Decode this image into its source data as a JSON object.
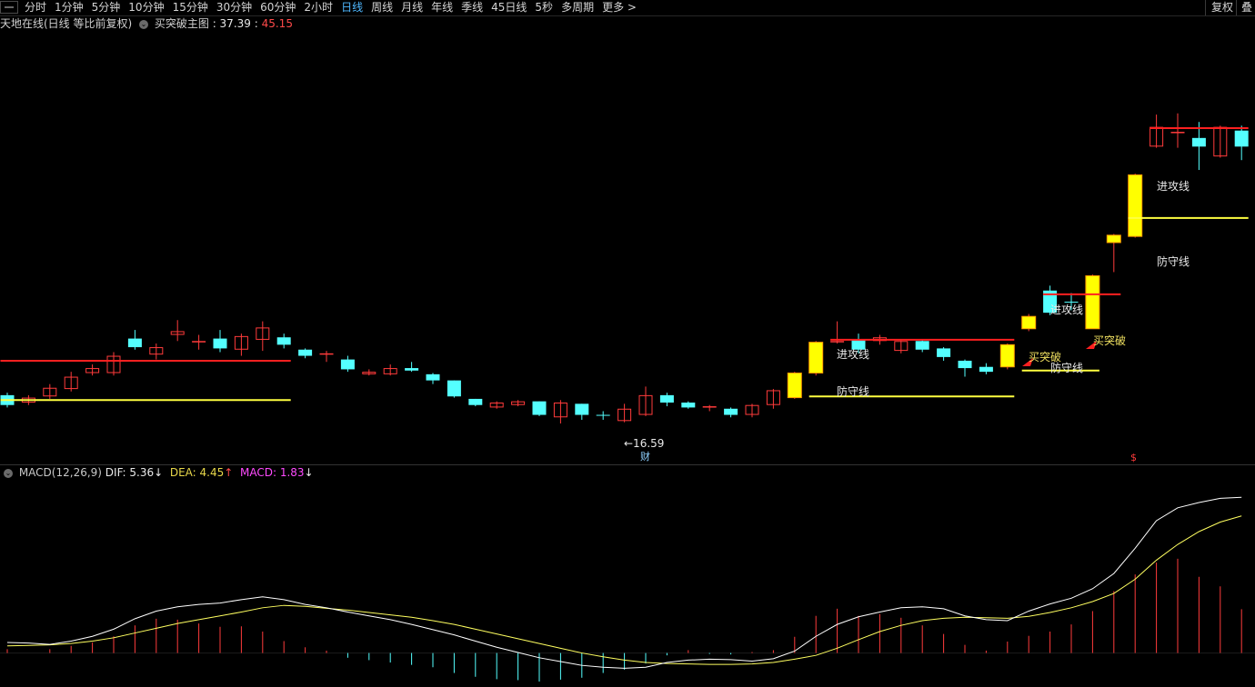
{
  "toolbar": {
    "periods": [
      "分时",
      "1分钟",
      "5分钟",
      "10分钟",
      "15分钟",
      "30分钟",
      "60分钟",
      "2小时",
      "日线",
      "周线",
      "月线",
      "年线",
      "季线",
      "45日线",
      "5秒",
      "多周期",
      "更多 >"
    ],
    "active_period": "日线",
    "restore_label": "复权",
    "overlay_label": "叠"
  },
  "info": {
    "stock_title": "天地在线(日线 等比前复权)",
    "indicator_name": "买突破主图",
    "value1": "37.39",
    "value2": "45.15"
  },
  "macd": {
    "name": "MACD(12,26,9)",
    "dif_label": "DIF:",
    "dif_value": "5.36",
    "dif_arrow": "↓",
    "dea_label": "DEA:",
    "dea_value": "4.45",
    "dea_arrow": "↑",
    "macd_label": "MACD:",
    "macd_value": "1.83",
    "macd_arrow": "↓"
  },
  "annotations": {
    "low_price": "←16.59",
    "finance_tag": "财",
    "dollar_tag": "$",
    "attack_line": "进攻线",
    "defense_line": "防守线",
    "buy_break": "买突破"
  },
  "colors": {
    "up": "#ff3b3b",
    "down": "#54ffff",
    "signal": "#ffff00",
    "attack": "#ff2020",
    "defense": "#ffff40",
    "dif": "#ffffff",
    "dea": "#ffff60"
  },
  "chart_data": {
    "type": "candlestick",
    "ylim": [
      15,
      50
    ],
    "candles": [
      {
        "o": 20.4,
        "c": 19.6,
        "h": 20.6,
        "l": 19.4,
        "t": "down"
      },
      {
        "o": 19.8,
        "c": 20.2,
        "h": 20.4,
        "l": 19.6,
        "t": "up"
      },
      {
        "o": 20.3,
        "c": 21.0,
        "h": 21.3,
        "l": 20.1,
        "t": "up"
      },
      {
        "o": 20.9,
        "c": 21.9,
        "h": 22.3,
        "l": 20.7,
        "t": "up"
      },
      {
        "o": 22.2,
        "c": 22.6,
        "h": 22.9,
        "l": 22.0,
        "t": "up"
      },
      {
        "o": 22.2,
        "c": 23.6,
        "h": 23.9,
        "l": 22.0,
        "t": "up"
      },
      {
        "o": 25.0,
        "c": 24.3,
        "h": 25.7,
        "l": 24.1,
        "t": "down"
      },
      {
        "o": 23.7,
        "c": 24.3,
        "h": 24.6,
        "l": 23.3,
        "t": "up"
      },
      {
        "o": 25.3,
        "c": 25.6,
        "h": 26.5,
        "l": 24.8,
        "t": "up"
      },
      {
        "o": 24.7,
        "c": 24.8,
        "h": 25.3,
        "l": 24.1,
        "t": "up"
      },
      {
        "o": 25.0,
        "c": 24.2,
        "h": 25.7,
        "l": 23.9,
        "t": "down"
      },
      {
        "o": 24.1,
        "c": 25.2,
        "h": 25.4,
        "l": 23.6,
        "t": "up"
      },
      {
        "o": 24.9,
        "c": 25.9,
        "h": 26.4,
        "l": 24.0,
        "t": "up"
      },
      {
        "o": 25.1,
        "c": 24.5,
        "h": 25.4,
        "l": 24.2,
        "t": "down"
      },
      {
        "o": 24.1,
        "c": 23.6,
        "h": 24.2,
        "l": 23.4,
        "t": "down"
      },
      {
        "o": 23.7,
        "c": 23.8,
        "h": 24.0,
        "l": 23.1,
        "t": "up"
      },
      {
        "o": 23.3,
        "c": 22.5,
        "h": 23.6,
        "l": 22.3,
        "t": "down"
      },
      {
        "o": 22.3,
        "c": 22.1,
        "h": 22.5,
        "l": 22.0,
        "t": "up"
      },
      {
        "o": 22.1,
        "c": 22.6,
        "h": 22.9,
        "l": 22.0,
        "t": "up"
      },
      {
        "o": 22.6,
        "c": 22.4,
        "h": 23.1,
        "l": 22.3,
        "t": "down"
      },
      {
        "o": 22.1,
        "c": 21.6,
        "h": 22.2,
        "l": 21.3,
        "t": "down"
      },
      {
        "o": 21.6,
        "c": 20.3,
        "h": 21.6,
        "l": 20.2,
        "t": "down"
      },
      {
        "o": 20.1,
        "c": 19.6,
        "h": 20.1,
        "l": 19.5,
        "t": "down"
      },
      {
        "o": 19.4,
        "c": 19.8,
        "h": 19.9,
        "l": 19.3,
        "t": "up"
      },
      {
        "o": 19.6,
        "c": 19.9,
        "h": 20.0,
        "l": 19.5,
        "t": "up"
      },
      {
        "o": 19.9,
        "c": 18.8,
        "h": 19.9,
        "l": 18.7,
        "t": "down"
      },
      {
        "o": 18.6,
        "c": 19.8,
        "h": 20.0,
        "l": 18.1,
        "t": "up"
      },
      {
        "o": 19.7,
        "c": 18.8,
        "h": 19.7,
        "l": 18.4,
        "t": "down"
      },
      {
        "o": 18.8,
        "c": 18.8,
        "h": 19.1,
        "l": 18.4,
        "t": "down"
      },
      {
        "o": 18.3,
        "c": 19.3,
        "h": 19.7,
        "l": 18.2,
        "t": "up"
      },
      {
        "o": 18.8,
        "c": 20.4,
        "h": 21.1,
        "l": 18.7,
        "t": "up"
      },
      {
        "o": 20.4,
        "c": 19.8,
        "h": 20.6,
        "l": 19.5,
        "t": "down"
      },
      {
        "o": 19.8,
        "c": 19.4,
        "h": 19.9,
        "l": 19.3,
        "t": "down"
      },
      {
        "o": 19.5,
        "c": 19.5,
        "h": 19.6,
        "l": 19.1,
        "t": "up"
      },
      {
        "o": 19.3,
        "c": 18.8,
        "h": 19.4,
        "l": 18.6,
        "t": "down"
      },
      {
        "o": 18.8,
        "c": 19.6,
        "h": 19.7,
        "l": 18.6,
        "t": "up"
      },
      {
        "o": 19.6,
        "c": 20.8,
        "h": 20.9,
        "l": 19.3,
        "t": "up"
      },
      {
        "o": 20.2,
        "c": 22.2,
        "h": 22.3,
        "l": 20.1,
        "t": "signal"
      },
      {
        "o": 22.2,
        "c": 24.7,
        "h": 24.8,
        "l": 22.0,
        "t": "signal"
      },
      {
        "o": 24.8,
        "c": 24.8,
        "h": 26.4,
        "l": 24.6,
        "t": "up"
      },
      {
        "o": 24.9,
        "c": 24.1,
        "h": 25.4,
        "l": 23.8,
        "t": "down"
      },
      {
        "o": 24.8,
        "c": 25.1,
        "h": 25.3,
        "l": 24.5,
        "t": "up"
      },
      {
        "o": 24.0,
        "c": 24.8,
        "h": 24.9,
        "l": 23.8,
        "t": "up"
      },
      {
        "o": 24.8,
        "c": 24.1,
        "h": 24.9,
        "l": 23.9,
        "t": "down"
      },
      {
        "o": 24.2,
        "c": 23.5,
        "h": 24.3,
        "l": 23.2,
        "t": "down"
      },
      {
        "o": 23.2,
        "c": 22.6,
        "h": 23.3,
        "l": 21.9,
        "t": "down"
      },
      {
        "o": 22.7,
        "c": 22.3,
        "h": 23.0,
        "l": 22.1,
        "t": "down"
      },
      {
        "o": 22.7,
        "c": 24.5,
        "h": 24.6,
        "l": 22.5,
        "t": "signal"
      },
      {
        "o": 25.8,
        "c": 26.8,
        "h": 27.0,
        "l": 25.6,
        "t": "signal"
      },
      {
        "o": 28.9,
        "c": 27.1,
        "h": 29.3,
        "l": 26.9,
        "t": "down"
      },
      {
        "o": 28.0,
        "c": 28.0,
        "h": 28.7,
        "l": 27.3,
        "t": "down"
      },
      {
        "o": 25.8,
        "c": 30.1,
        "h": 30.2,
        "l": 25.8,
        "t": "signal"
      },
      {
        "o": 32.8,
        "c": 33.4,
        "h": 33.5,
        "l": 30.4,
        "t": "signal"
      },
      {
        "o": 33.3,
        "c": 38.3,
        "h": 38.4,
        "l": 33.2,
        "t": "signal"
      },
      {
        "o": 40.6,
        "c": 42.2,
        "h": 43.2,
        "l": 40.5,
        "t": "up"
      },
      {
        "o": 41.8,
        "c": 41.8,
        "h": 43.3,
        "l": 40.5,
        "t": "up"
      },
      {
        "o": 41.3,
        "c": 40.6,
        "h": 42.6,
        "l": 38.7,
        "t": "down"
      },
      {
        "o": 39.8,
        "c": 42.2,
        "h": 42.3,
        "l": 39.7,
        "t": "up"
      },
      {
        "o": 40.6,
        "c": 41.9,
        "h": 42.3,
        "l": 39.5,
        "t": "down"
      }
    ],
    "attack_lines": [
      {
        "from": 0,
        "to": 13,
        "y": 23.2
      },
      {
        "from": 39,
        "to": 47,
        "y": 24.9
      },
      {
        "from": 49,
        "to": 52,
        "y": 28.6
      },
      {
        "from": 54,
        "to": 58,
        "y": 42.1
      }
    ],
    "defense_lines": [
      {
        "from": 0,
        "to": 13,
        "y": 20.0
      },
      {
        "from": 38,
        "to": 47,
        "y": 20.3
      },
      {
        "from": 48,
        "to": 51,
        "y": 22.4
      },
      {
        "from": 53,
        "to": 58,
        "y": 34.8
      }
    ],
    "macd": {
      "ylim": [
        -0.6,
        3.6
      ],
      "dif": [
        0.22,
        0.21,
        0.18,
        0.25,
        0.35,
        0.5,
        0.72,
        0.88,
        0.97,
        1.02,
        1.05,
        1.12,
        1.18,
        1.12,
        1.02,
        0.95,
        0.86,
        0.78,
        0.7,
        0.6,
        0.49,
        0.38,
        0.25,
        0.12,
        0.01,
        -0.1,
        -0.18,
        -0.26,
        -0.3,
        -0.32,
        -0.3,
        -0.2,
        -0.15,
        -0.13,
        -0.14,
        -0.17,
        -0.12,
        0.04,
        0.35,
        0.6,
        0.76,
        0.86,
        0.95,
        0.97,
        0.93,
        0.78,
        0.7,
        0.68,
        0.88,
        1.03,
        1.15,
        1.35,
        1.67,
        2.2,
        2.78,
        3.05,
        3.16,
        3.25,
        3.27
      ],
      "dea": [
        0.15,
        0.16,
        0.17,
        0.2,
        0.25,
        0.32,
        0.42,
        0.52,
        0.62,
        0.7,
        0.78,
        0.86,
        0.95,
        1.0,
        0.98,
        0.94,
        0.9,
        0.85,
        0.8,
        0.75,
        0.68,
        0.6,
        0.5,
        0.4,
        0.3,
        0.2,
        0.1,
        0.0,
        -0.08,
        -0.15,
        -0.2,
        -0.22,
        -0.23,
        -0.24,
        -0.24,
        -0.23,
        -0.2,
        -0.13,
        -0.05,
        0.1,
        0.28,
        0.45,
        0.58,
        0.68,
        0.73,
        0.75,
        0.74,
        0.73,
        0.77,
        0.85,
        0.95,
        1.08,
        1.25,
        1.55,
        1.95,
        2.28,
        2.55,
        2.75,
        2.88
      ],
      "hist": [
        0.08,
        0.0,
        0.08,
        0.15,
        0.22,
        0.35,
        0.58,
        0.72,
        0.7,
        0.62,
        0.55,
        0.56,
        0.45,
        0.25,
        0.12,
        0.05,
        -0.1,
        -0.15,
        -0.2,
        -0.25,
        -0.3,
        -0.42,
        -0.5,
        -0.55,
        -0.57,
        -0.6,
        -0.56,
        -0.52,
        -0.42,
        -0.35,
        -0.22,
        -0.05,
        0.06,
        -0.02,
        -0.03,
        0.02,
        0.06,
        0.34,
        0.78,
        0.93,
        0.78,
        0.82,
        0.74,
        0.58,
        0.4,
        0.17,
        0.05,
        0.24,
        0.36,
        0.45,
        0.6,
        0.88,
        1.3,
        1.65,
        1.9,
        1.98,
        1.6,
        1.4,
        0.92
      ]
    }
  }
}
